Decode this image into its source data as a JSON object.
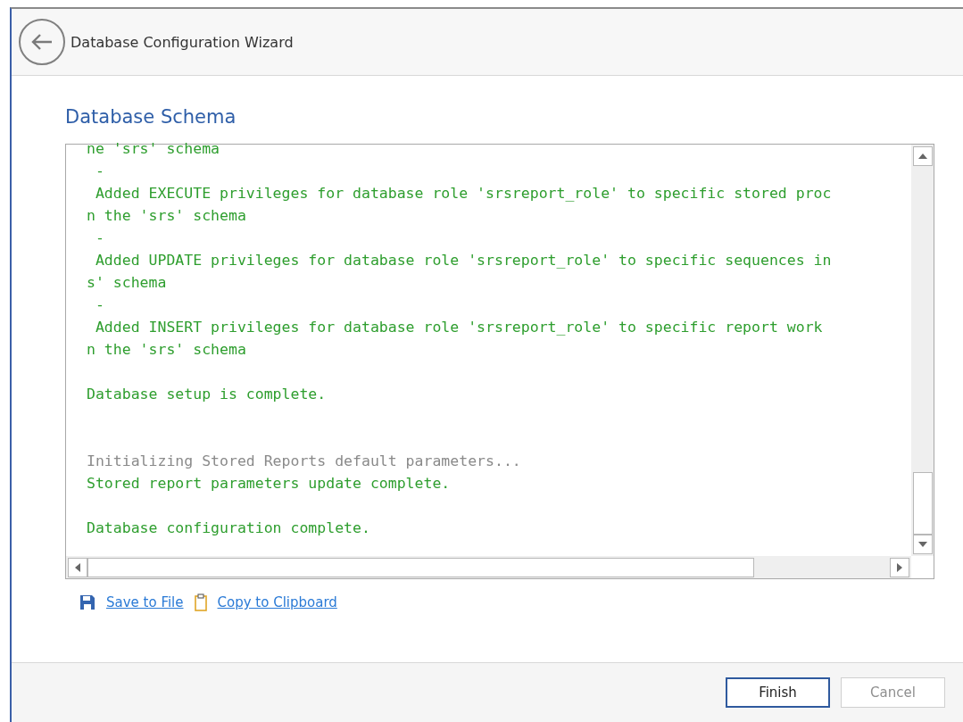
{
  "window": {
    "title": "Database Configuration Wizard"
  },
  "page_title": "Database Schema",
  "log": [
    {
      "kind": "success",
      "text": "ne 'srs' schema"
    },
    {
      "kind": "success",
      "text": " -"
    },
    {
      "kind": "success",
      "text": " Added EXECUTE privileges for database role 'srsreport_role' to specific stored proc"
    },
    {
      "kind": "success",
      "text": "n the 'srs' schema"
    },
    {
      "kind": "success",
      "text": " -"
    },
    {
      "kind": "success",
      "text": " Added UPDATE privileges for database role 'srsreport_role' to specific sequences in"
    },
    {
      "kind": "success",
      "text": "s' schema"
    },
    {
      "kind": "success",
      "text": " -"
    },
    {
      "kind": "success",
      "text": " Added INSERT privileges for database role 'srsreport_role' to specific report work"
    },
    {
      "kind": "success",
      "text": "n the 'srs' schema"
    },
    {
      "kind": "blank"
    },
    {
      "kind": "success",
      "text": "Database setup is complete."
    },
    {
      "kind": "blank"
    },
    {
      "kind": "blank"
    },
    {
      "kind": "info",
      "text": "Initializing Stored Reports default parameters..."
    },
    {
      "kind": "success",
      "text": "Stored report parameters update complete."
    },
    {
      "kind": "blank"
    },
    {
      "kind": "success",
      "text": "Database configuration complete."
    }
  ],
  "links": [
    {
      "kind": "save",
      "label": "Save to File"
    },
    {
      "kind": "clipboard",
      "label": "Copy to Clipboard"
    }
  ],
  "buttons": [
    {
      "label": "Finish",
      "default": true,
      "disabled": false
    },
    {
      "label": "Cancel",
      "default": false,
      "disabled": true
    }
  ]
}
